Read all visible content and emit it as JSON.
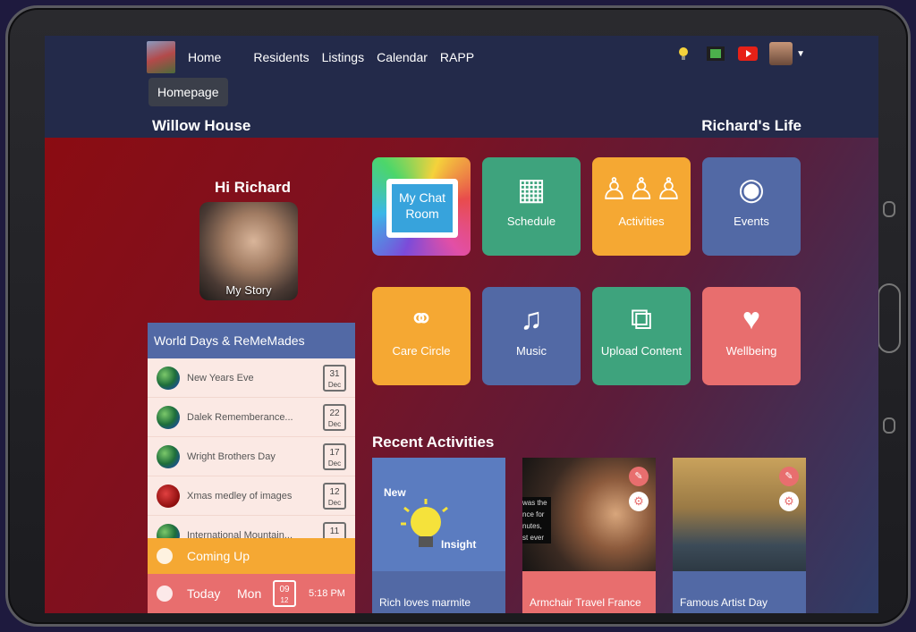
{
  "nav": {
    "home": "Home",
    "residents": "Residents",
    "listings": "Listings",
    "calendar": "Calendar",
    "rapp": "RAPP"
  },
  "homepage_button": "Homepage",
  "site_title": "Willow House",
  "life_title": "Richard's Life",
  "greeting": "Hi Richard",
  "my_story_label": "My Story",
  "world_days": {
    "title": "World Days & ReMeMades",
    "items": [
      {
        "name": "New Years Eve",
        "day": "31",
        "month": "Dec",
        "icon": "globe-icon"
      },
      {
        "name": "Dalek Rememberance...",
        "day": "22",
        "month": "Dec",
        "icon": "globe-icon"
      },
      {
        "name": "Wright Brothers Day",
        "day": "17",
        "month": "Dec",
        "icon": "globe-icon"
      },
      {
        "name": "Xmas medley of images",
        "day": "12",
        "month": "Dec",
        "icon": "red-image-icon"
      },
      {
        "name": "International Mountain...",
        "day": "11",
        "month": "",
        "icon": "globe-icon"
      }
    ]
  },
  "coming_up": "Coming Up",
  "today": {
    "label": "Today",
    "day_name": "Mon",
    "date": "09",
    "month": "12",
    "time": "5:18 PM"
  },
  "tiles": [
    {
      "label": "My Chat Room",
      "color": "#f5d23b"
    },
    {
      "label": "Schedule",
      "color": "#3ea37d",
      "icon": "calendar-icon"
    },
    {
      "label": "Activities",
      "color": "#f5a833",
      "icon": "people-icon"
    },
    {
      "label": "Events",
      "color": "#5269a5",
      "icon": "camera-icon"
    },
    {
      "label": "Care Circle",
      "color": "#f5a833",
      "icon": "care-circle-icon"
    },
    {
      "label": "Music",
      "color": "#5269a5",
      "icon": "music-icon"
    },
    {
      "label": "Upload Content",
      "color": "#3ea37d",
      "icon": "upload-icon"
    },
    {
      "label": "Wellbeing",
      "color": "#e86e6e",
      "icon": "heart-icon"
    }
  ],
  "recent": {
    "title": "Recent Activities",
    "cards": [
      {
        "title": "Rich loves marmite",
        "overlay_new": "New",
        "overlay_insight": "Insight"
      },
      {
        "title": "Armchair Travel France",
        "snippet": "was the\nnce for\nnutes,\nst ever"
      },
      {
        "title": "Famous Artist Day"
      }
    ]
  },
  "chat_room_lines": [
    "My Chat",
    "Room"
  ],
  "colors": {
    "accent_blue": "#5269a5",
    "accent_orange": "#f5a833",
    "accent_green": "#3ea37d",
    "accent_red": "#e86e6e"
  }
}
